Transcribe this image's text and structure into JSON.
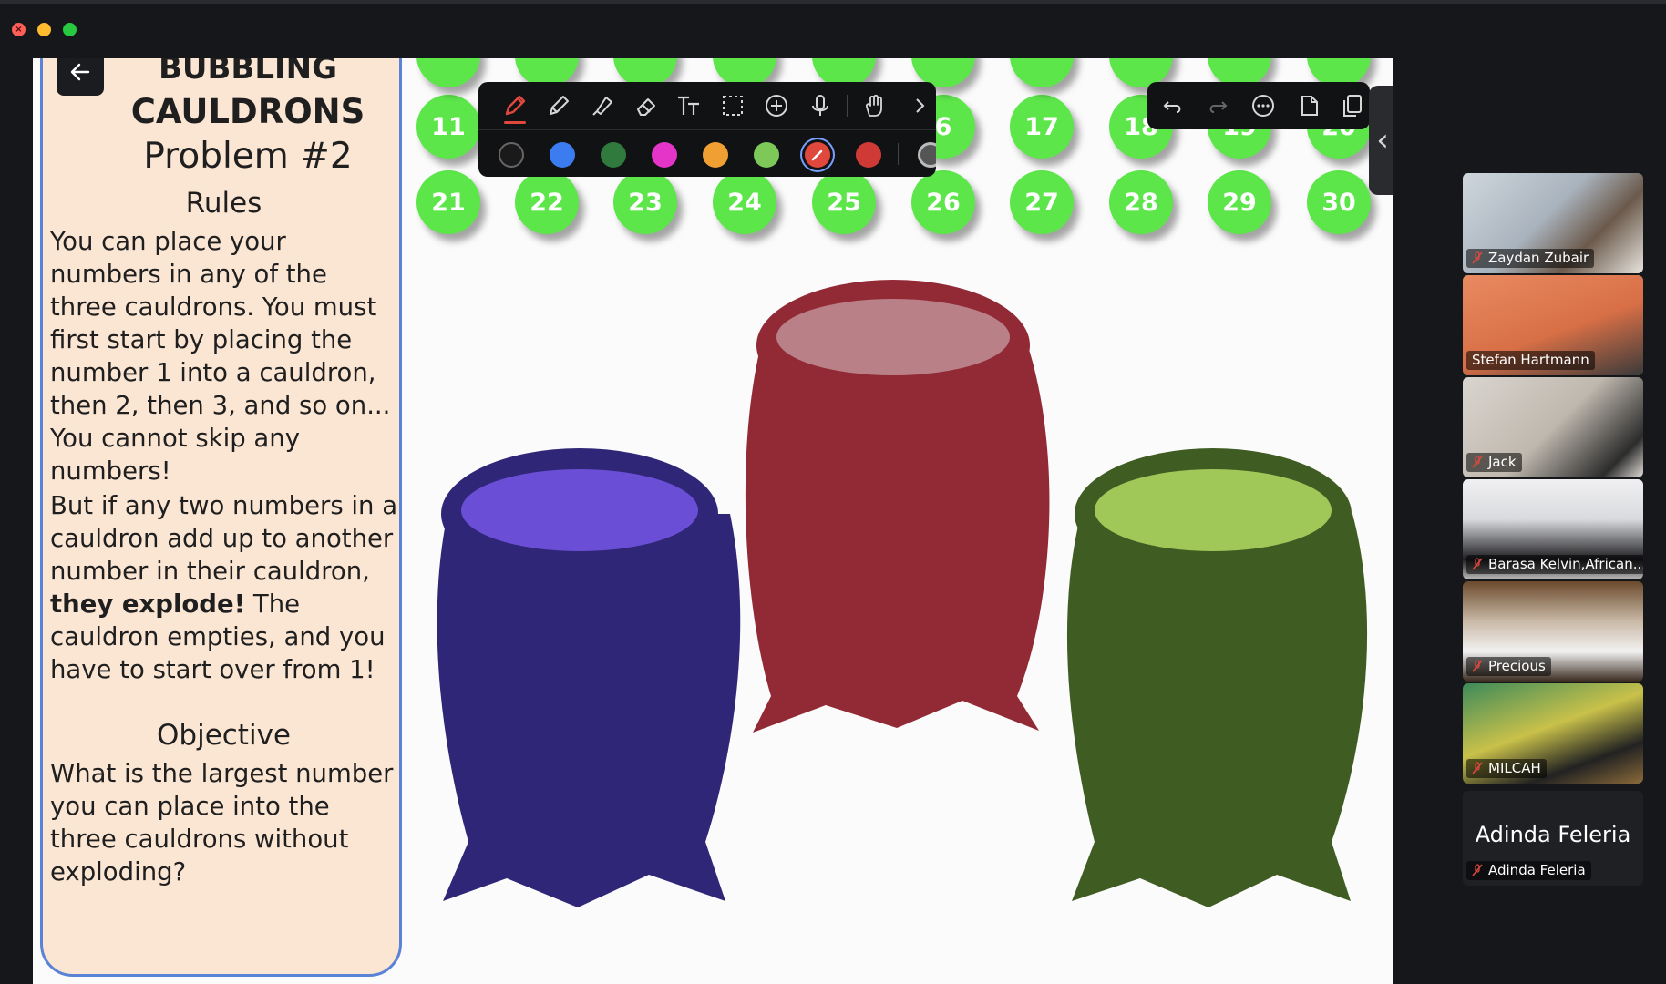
{
  "card": {
    "title_line1": "BUBBLING",
    "title_line2": "CAULDRONS",
    "title_line3": "Problem #2",
    "rules_heading": "Rules",
    "rules_p1": "You can place your numbers in any of the three cauldrons.  You must first start by placing the number 1 into a cauldron, then 2, then 3, and so on... You cannot skip any numbers!",
    "rules_p2_start": "But if any two numbers in a cauldron add up to another number in their cauldron, ",
    "rules_p2_bold": "they explode!",
    "rules_p2_end": " The cauldron empties, and you have to start over from 1!",
    "objective_heading": "Objective",
    "objective_text": "What is the largest number you can place into the three cauldrons without exploding?"
  },
  "numbers": {
    "row2": [
      "11",
      "",
      "",
      "",
      "",
      "6",
      "17",
      "18",
      "19",
      "20"
    ],
    "row3": [
      "21",
      "22",
      "23",
      "24",
      "25",
      "26",
      "27",
      "28",
      "29",
      "30"
    ]
  },
  "toolbar": {
    "tools": [
      "pen-tool-icon",
      "pencil-tool-icon",
      "highlighter-tool-icon",
      "eraser-tool-icon",
      "text-tool-icon",
      "select-tool-icon",
      "add-tool-icon",
      "mic-tool-icon",
      "hand-tool-icon",
      "chevron-right-icon"
    ],
    "colors": [
      "#1a1a1a",
      "#3b7cf0",
      "#2f7a3c",
      "#e535c8",
      "#f0a032",
      "#7ec85a",
      "#e0483e",
      "#d03a36"
    ],
    "actions": [
      "undo-icon",
      "redo-icon",
      "more-icon",
      "share-icon",
      "copy-icon"
    ]
  },
  "cauldrons": {
    "purple": {
      "body": "#302677",
      "rim": "#6a4fd6"
    },
    "red": {
      "body": "#922a36",
      "rim": "#b98088"
    },
    "green": {
      "body": "#3f5c23",
      "rim": "#9fc858"
    }
  },
  "participants": [
    {
      "name": "Zaydan Zubair",
      "muted": true
    },
    {
      "name": "Stefan Hartmann",
      "muted": false
    },
    {
      "name": "Jack",
      "muted": true
    },
    {
      "name": "Barasa Kelvin,African...",
      "muted": true
    },
    {
      "name": "Precious",
      "muted": true
    },
    {
      "name": "MILCAH",
      "muted": true
    },
    {
      "name": "Adinda Feleria",
      "muted": true
    }
  ],
  "participant_big_name": "Adinda Feleria"
}
